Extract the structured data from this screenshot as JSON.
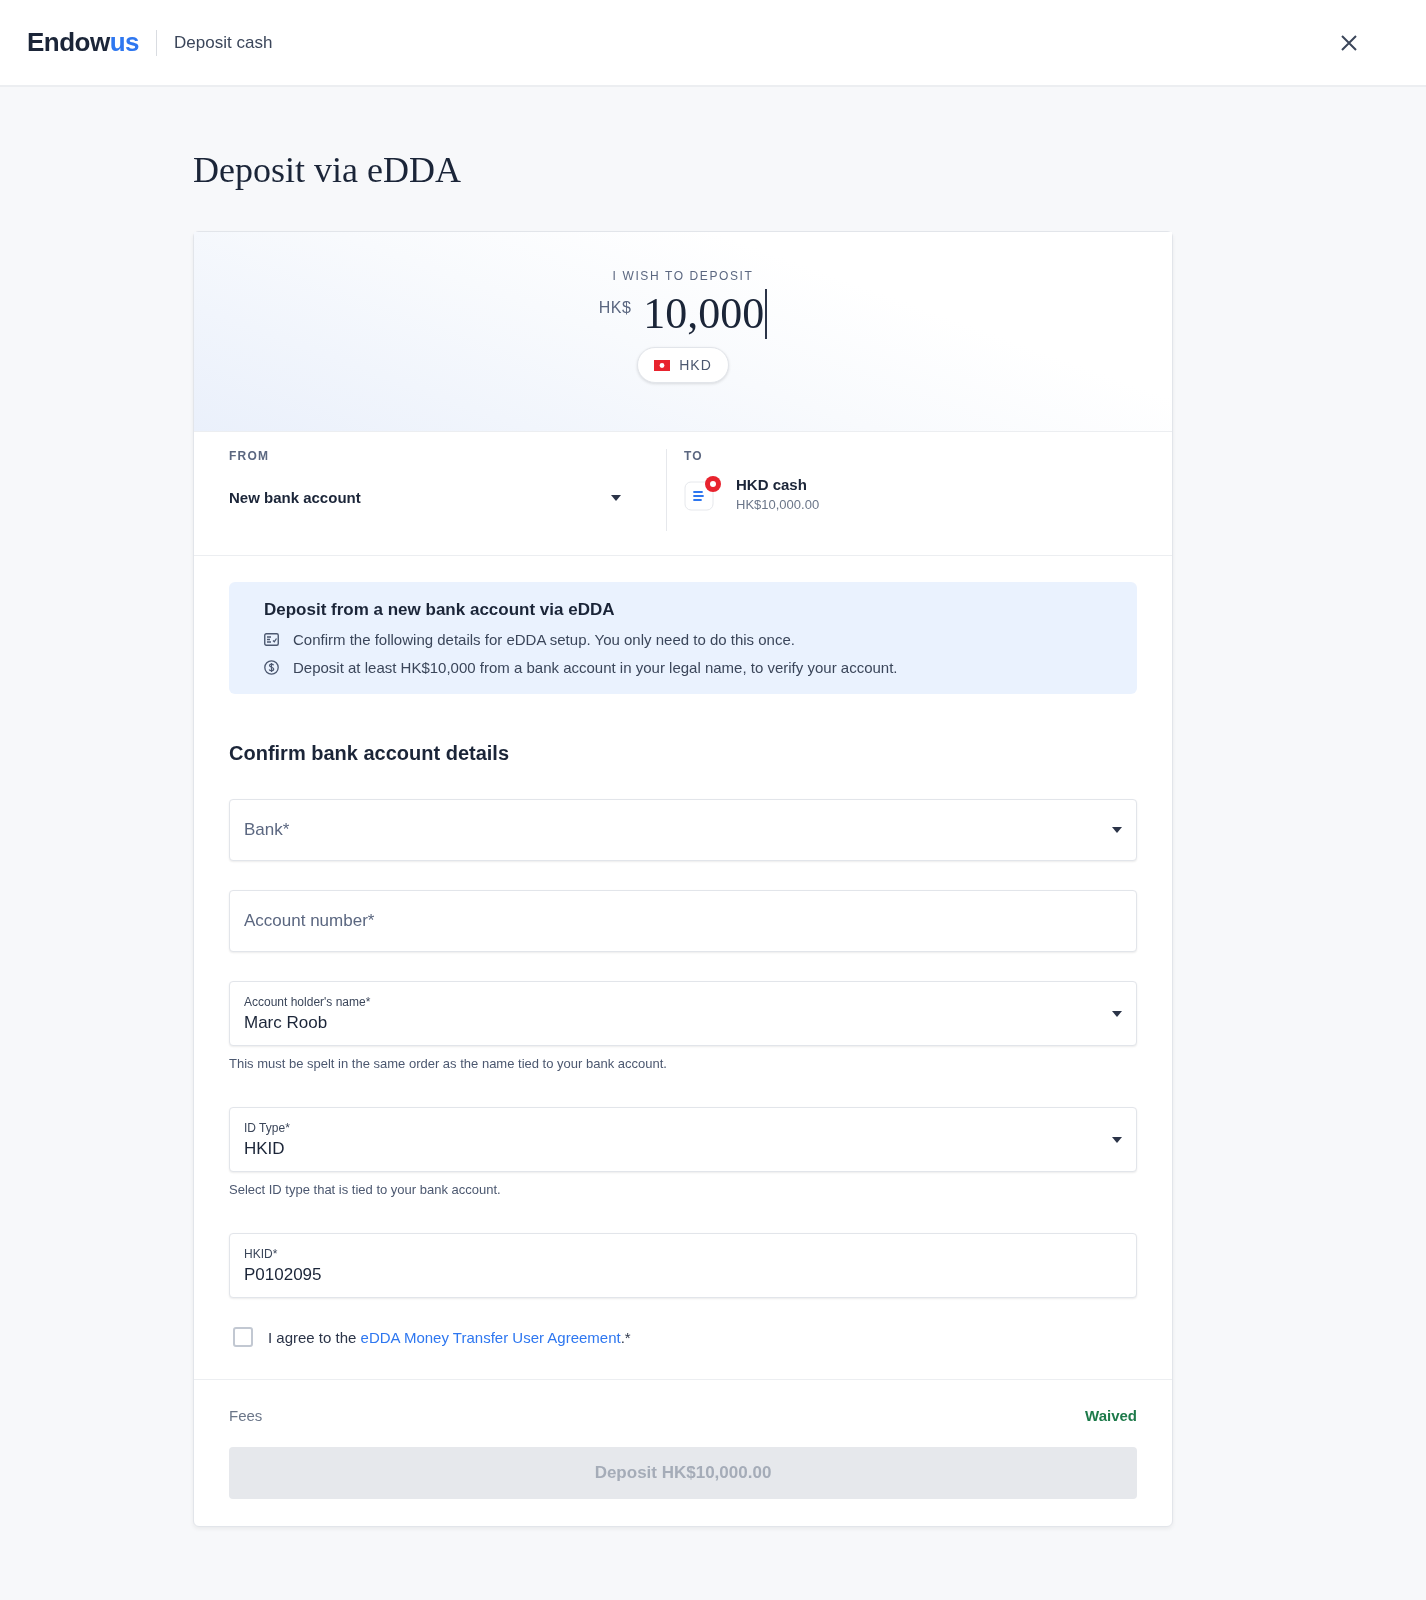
{
  "header": {
    "logo": [
      "Endow",
      "us"
    ],
    "title": "Deposit cash"
  },
  "page_title": "Deposit via eDDA",
  "amount": {
    "label": "I WISH TO DEPOSIT",
    "currency_symbol": "HK$",
    "value": "10,000",
    "currency": "HKD"
  },
  "from": {
    "label": "FROM",
    "value": "New bank account"
  },
  "to": {
    "label": "TO",
    "name": "HKD cash",
    "amount": "HK$10,000.00"
  },
  "info": {
    "title": "Deposit from a new bank account via eDDA",
    "items": [
      {
        "kind": "form",
        "text": "Confirm the following details for eDDA setup. You only need to do this once."
      },
      {
        "kind": "money",
        "text": "Deposit at least HK$10,000 from a bank account in your legal name, to verify your account."
      }
    ]
  },
  "section_title": "Confirm bank account details",
  "fields": [
    {
      "kind": "select",
      "label": "Bank*"
    },
    {
      "kind": "text",
      "label": "Account number*"
    },
    {
      "kind": "select",
      "label": "Account holder's name*",
      "value": "Marc Roob",
      "helper": "This must be spelt in the same order as the name tied to your bank account."
    },
    {
      "kind": "select",
      "label": "ID Type*",
      "value": "HKID",
      "helper": "Select ID type that is tied to your bank account."
    },
    {
      "kind": "text",
      "label": "HKID*",
      "value": "P0102095"
    }
  ],
  "agreement": {
    "checked": false,
    "before": "I agree to the ",
    "link": "eDDA Money Transfer User Agreement",
    "after": ".*"
  },
  "fees": {
    "label": "Fees",
    "value": "Waived"
  },
  "submit": {
    "label": "Deposit HK$10,000.00",
    "disabled": true
  }
}
